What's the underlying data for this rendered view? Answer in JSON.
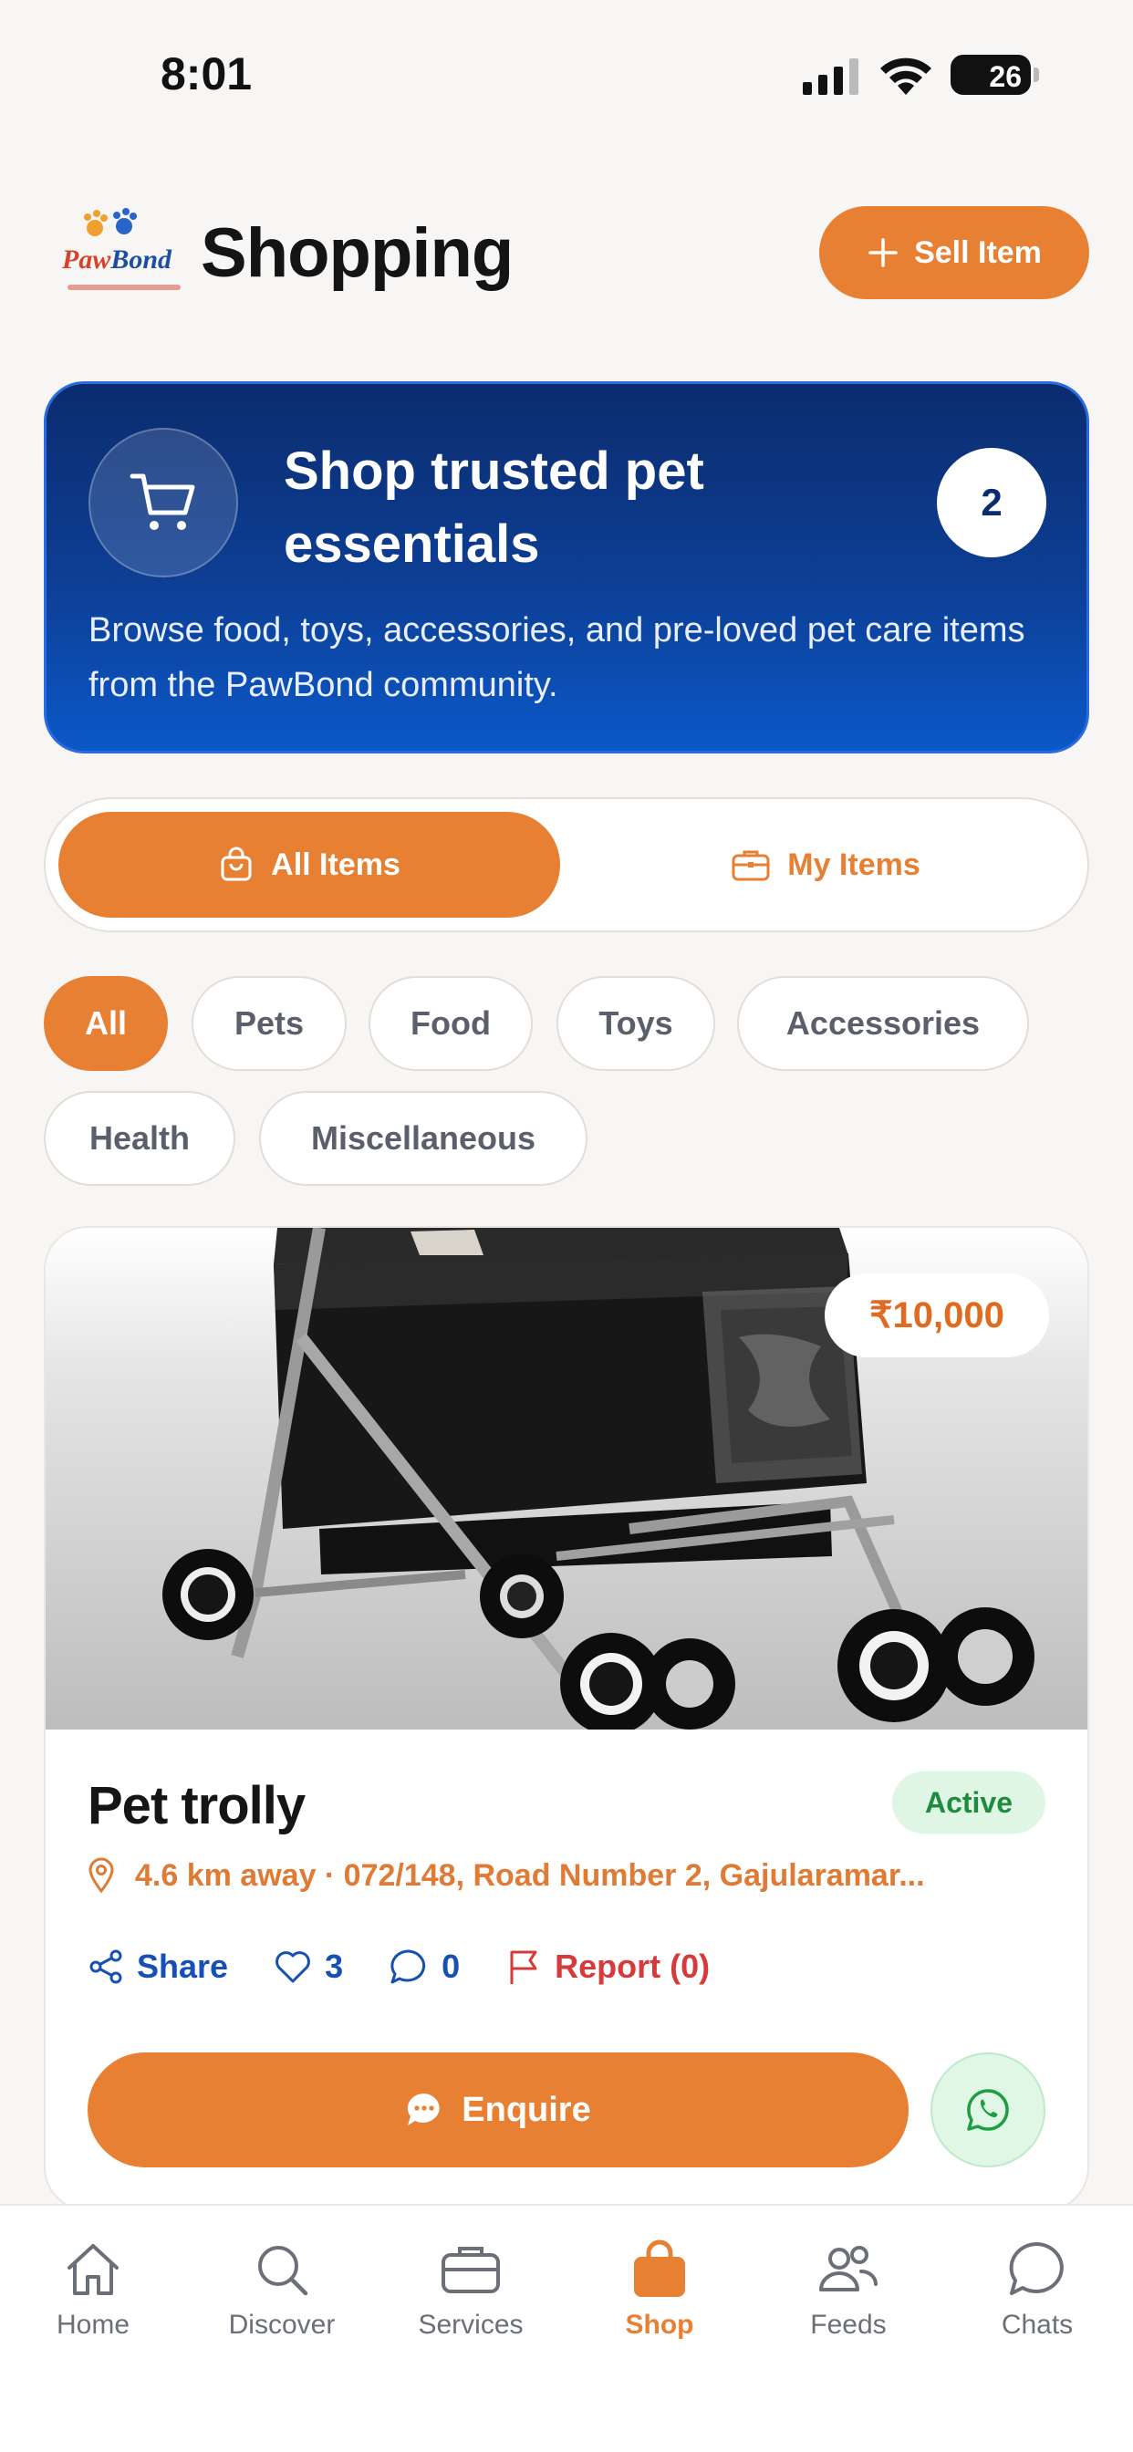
{
  "status_bar": {
    "time": "8:01",
    "battery": "26"
  },
  "header": {
    "logo_line1": "Paw",
    "logo_line2": "Bond",
    "title": "Shopping",
    "sell_label": "Sell Item"
  },
  "banner": {
    "title": "Shop trusted pet essentials",
    "count": "2",
    "description": "Browse food, toys, accessories, and pre-loved pet care items from the PawBond community."
  },
  "segments": {
    "all_items": "All Items",
    "my_items": "My Items"
  },
  "categories": [
    "All",
    "Pets",
    "Food",
    "Toys",
    "Accessories",
    "Health",
    "Miscellaneous"
  ],
  "card": {
    "price": "₹10,000",
    "title": "Pet trolly",
    "status": "Active",
    "location": "4.6 km away · 072/148, Road Number 2, Gajularamar...",
    "share": "Share",
    "likes": "3",
    "comments": "0",
    "report": "Report (0)",
    "enquire": "Enquire"
  },
  "tabs": [
    "Home",
    "Discover",
    "Services",
    "Shop",
    "Feeds",
    "Chats"
  ],
  "colors": {
    "accent": "#e88034",
    "banner": "#0d3f95",
    "link": "#1650b4",
    "danger": "#d63a3a",
    "success": "#1f8b3f"
  }
}
